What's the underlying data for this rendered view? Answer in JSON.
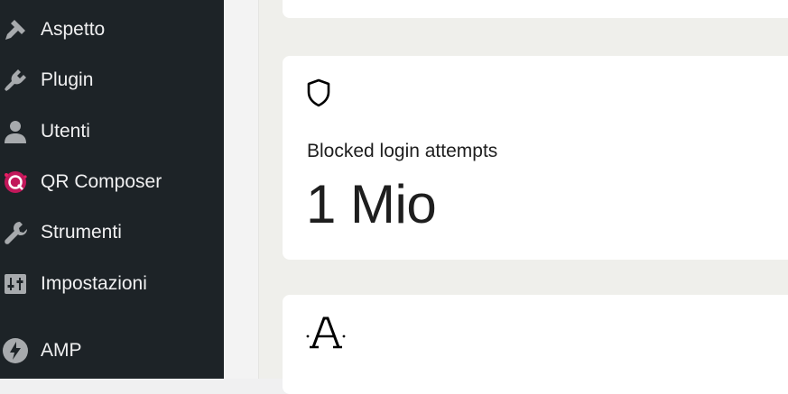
{
  "sidebar": {
    "items": [
      {
        "label": "Aspetto",
        "icon": "paintbrush-icon"
      },
      {
        "label": "Plugin",
        "icon": "plugin-icon"
      },
      {
        "label": "Utenti",
        "icon": "users-icon"
      },
      {
        "label": "QR Composer",
        "icon": "qr-composer-logo-icon"
      },
      {
        "label": "Strumenti",
        "icon": "wrench-icon"
      },
      {
        "label": "Impostazioni",
        "icon": "settings-sliders-icon"
      },
      {
        "label": "AMP",
        "icon": "amp-bolt-icon"
      }
    ]
  },
  "main": {
    "stat_card": {
      "icon": "shield-icon",
      "title": "Blocked login attempts",
      "value": "1 Mio"
    },
    "font_card": {
      "icon": "font-a-icon"
    }
  },
  "colors": {
    "sidebar_bg": "#1d2327",
    "sidebar_text": "#f0f0f1",
    "icon_gray": "#a7aaad",
    "content_bg": "#efefeb",
    "card_bg": "#ffffff",
    "qr_accent": "#c2185b"
  }
}
